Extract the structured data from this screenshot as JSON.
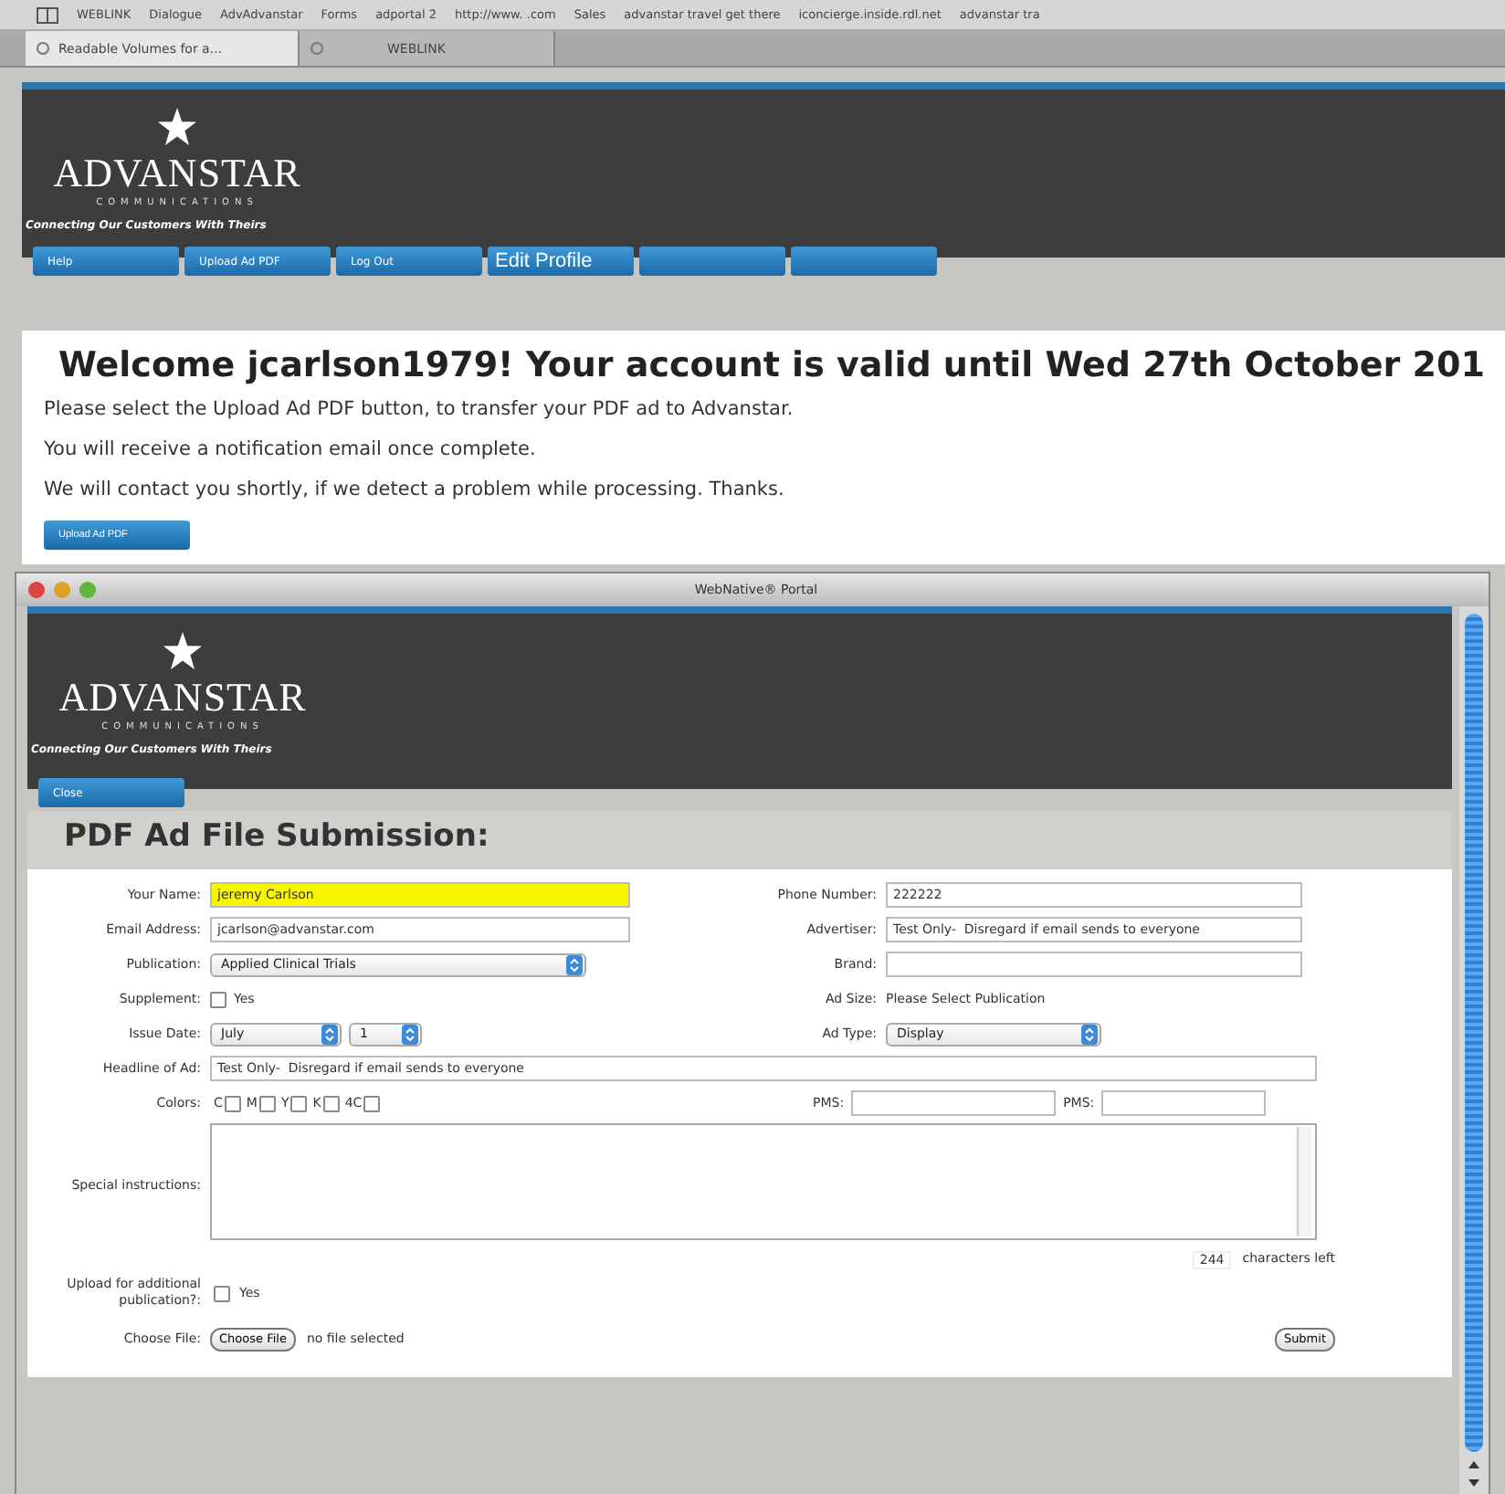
{
  "browser": {
    "bookmarks": [
      "WEBLINK",
      "Dialogue",
      "AdvAdvanstar",
      "Forms",
      "adportal 2",
      "http://www. .com",
      "Sales",
      "advanstar travel get there",
      "iconcierge.inside.rdl.net",
      "advanstar tra"
    ],
    "tabs": [
      {
        "label": "Readable Volumes for a...",
        "selected": true
      },
      {
        "label": "WEBLINK",
        "selected": false
      }
    ]
  },
  "portal": {
    "logo": {
      "name": "ADVANSTAR",
      "sub": "COMMUNICATIONS",
      "tagline": "Connecting Our Customers With Theirs"
    },
    "nav": [
      {
        "kind": "labeled",
        "label": "Help"
      },
      {
        "kind": "labeled",
        "label": "Upload Ad PDF"
      },
      {
        "kind": "labeled",
        "label": "Log Out"
      },
      {
        "kind": "current",
        "label": "Edit Profile"
      },
      {
        "kind": "empty"
      },
      {
        "kind": "empty"
      }
    ],
    "welcome": {
      "title": "Welcome jcarlson1979! Your account is valid until Wed 27th October 201",
      "lines": [
        "Please select the Upload Ad PDF button, to transfer your PDF ad to Advanstar.",
        "You will receive a notification email once complete.",
        "We will contact you shortly, if we detect a problem while processing. Thanks."
      ],
      "button": "Upload Ad PDF"
    }
  },
  "window": {
    "title": "WebNative® Portal",
    "logo": {
      "name": "ADVANSTAR",
      "sub": "COMMUNICATIONS",
      "tagline": "Connecting Our Customers With Theirs"
    },
    "close_button": "Close",
    "heading": "PDF Ad File Submission:",
    "form": {
      "left_fields": [
        {
          "kind": "text",
          "label": "Your Name:",
          "value": "jeremy Carlson",
          "highlighted": true
        },
        {
          "kind": "text",
          "label": "Email Address:",
          "value": "jcarlson@advanstar.com",
          "highlighted": false
        },
        {
          "kind": "select",
          "label": "Publication:",
          "value": "Applied Clinical Trials"
        },
        {
          "kind": "checkbox",
          "label": "Supplement:",
          "option": "Yes",
          "checked": false
        },
        {
          "kind": "selects",
          "label": "Issue Date:",
          "values": [
            "July",
            "1"
          ]
        }
      ],
      "right_fields": [
        {
          "kind": "text",
          "label": "Phone Number:",
          "value": "222222",
          "highlighted": false
        },
        {
          "kind": "text",
          "label": "Advertiser:",
          "value": "Test Only-  Disregard if email sends to everyone",
          "highlighted": false
        },
        {
          "kind": "text",
          "label": "Brand:",
          "highlighted": false
        },
        {
          "kind": "info",
          "label": "Ad Size:",
          "value": "Please Select Publication"
        },
        {
          "kind": "select",
          "label": "Ad Type:",
          "value": "Display"
        }
      ],
      "headline": {
        "label": "Headline of Ad:",
        "value": "Test Only-  Disregard if email sends to everyone"
      },
      "colors": {
        "label": "Colors:",
        "options": [
          {
            "label": "C",
            "checked": false
          },
          {
            "label": "M",
            "checked": false
          },
          {
            "label": "Y",
            "checked": false
          },
          {
            "label": "K",
            "checked": false
          },
          {
            "label": "4C",
            "checked": false
          }
        ],
        "pms": [
          "PMS:",
          "PMS:"
        ]
      },
      "special": {
        "label": "Special instructions:",
        "counter": "244",
        "counter_label": "characters left"
      },
      "additional": {
        "label": "Upload for additional publication?:",
        "option": "Yes",
        "checked": false
      },
      "file": {
        "label": "Choose File:",
        "button": "Choose File",
        "status": "no file selected"
      },
      "submit": "Submit"
    }
  }
}
